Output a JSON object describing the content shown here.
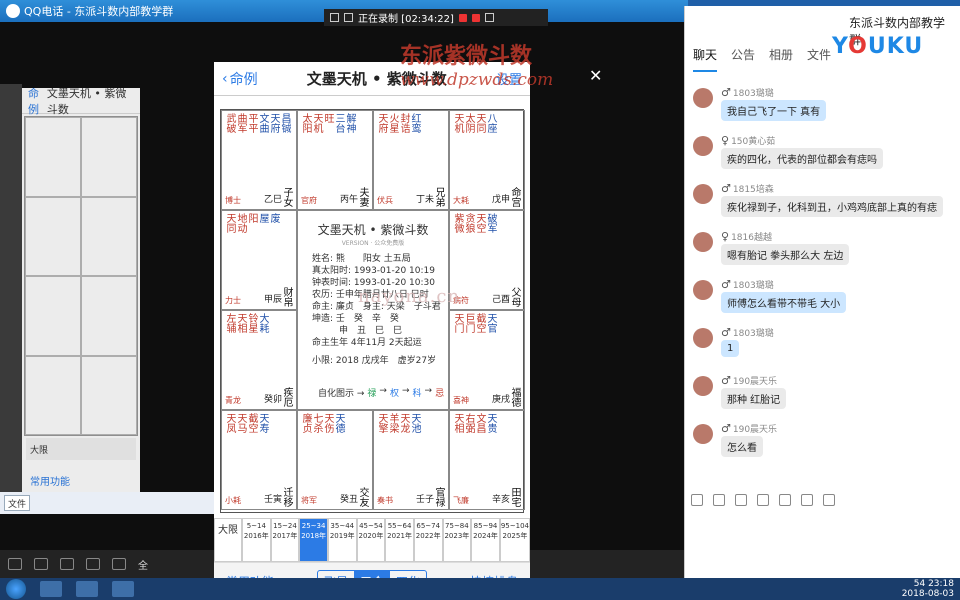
{
  "qq": {
    "title": "QQ电话 - 东派斗数内部教学群",
    "bottom_bar": "全"
  },
  "recording": {
    "label": "正在录制 [02:34:22]"
  },
  "watermark": {
    "line1": "东派紫微斗数",
    "line2": "www.dpzwds.com",
    "line3": "nayona.cn"
  },
  "left_phone": {
    "back": "命例",
    "title": "文墨天机 • 紫微斗数",
    "btn": "常用功能",
    "tab": "飞星",
    "row_label": "大限"
  },
  "phone": {
    "back": "命例",
    "title": "文墨天机 • 紫微斗数",
    "settings": "设置",
    "center": {
      "title": "文墨天机 • 紫微斗数",
      "sub": "VERSION · 公众免费版",
      "lines": [
        "姓名: 熊　　阳女 土五局",
        "真太阳时: 1993-01-20 10:19",
        "钟表时间: 1993-01-20 10:30",
        "农历: 壬申年腊月廿八日 巳时",
        "命主: 廉贞　身主: 天梁　子斗君",
        "坤造: 壬　癸　辛　癸",
        "　　　申　丑　巳　巳",
        "命主生年 4年11月 2天起运"
      ],
      "xiao": "小限: 2018 戊戌年　虚岁27岁",
      "legend_prefix": "自化图示 →",
      "legend_items": [
        "禄",
        "权",
        "科",
        "忌"
      ]
    },
    "cells": [
      {
        "stars": [
          "武破",
          "曲军",
          "平平"
        ],
        "blue": [
          "文曲",
          "天府",
          "昌铖"
        ],
        "palace": "子女",
        "gz": "乙巳",
        "label": "博士"
      },
      {
        "stars": [
          "太阳",
          "天机",
          "旺"
        ],
        "blue": [
          "三台",
          "解神"
        ],
        "palace": "夫妻",
        "gz": "丙午",
        "label": "官府"
      },
      {
        "stars": [
          "天府",
          "火星",
          "封诰"
        ],
        "blue": [
          "红鸾"
        ],
        "palace": "兄弟",
        "gz": "丁未",
        "label": "伏兵"
      },
      {
        "stars": [
          "天机",
          "太阴",
          "天同"
        ],
        "blue": [
          "八座"
        ],
        "palace": "命宫",
        "gz": "戊申",
        "label": "大耗"
      },
      {
        "stars": [
          "天同",
          "地动",
          "阳"
        ],
        "blue": [
          "屋",
          "废"
        ],
        "palace": "财帛",
        "gz": "甲辰",
        "label": "力士"
      },
      {
        "stars": [
          "紫微",
          "贪狼",
          "天空"
        ],
        "blue": [
          "破军"
        ],
        "palace": "父母",
        "gz": "己酉",
        "label": "病符"
      },
      {
        "stars": [
          "左辅",
          "天相",
          "铃星"
        ],
        "blue": [
          "大耗"
        ],
        "palace": "疾厄",
        "gz": "癸卯",
        "label": "青龙"
      },
      {
        "stars": [
          "天门",
          "巨门",
          "截空"
        ],
        "blue": [
          "天官"
        ],
        "palace": "福德",
        "gz": "庚戌",
        "label": "喜神"
      },
      {
        "stars": [
          "天凤",
          "天马",
          "截空"
        ],
        "blue": [
          "天寿"
        ],
        "palace": "迁移",
        "gz": "壬寅",
        "label": "小耗"
      },
      {
        "stars": [
          "廉贞",
          "七杀",
          "天伤"
        ],
        "blue": [
          "天德"
        ],
        "palace": "交友",
        "gz": "癸丑",
        "label": "将军"
      },
      {
        "stars": [
          "天擎",
          "羊梁",
          "天龙"
        ],
        "blue": [
          "天池"
        ],
        "palace": "官禄",
        "gz": "壬子",
        "label": "奏书"
      },
      {
        "stars": [
          "天相",
          "右弼",
          "文昌"
        ],
        "blue": [
          "天贵"
        ],
        "palace": "田宅",
        "gz": "辛亥",
        "label": "飞廉"
      }
    ],
    "dayun_header": [
      "大限",
      "流年"
    ],
    "dayun": [
      {
        "r1": "5~14",
        "r2": "2016年"
      },
      {
        "r1": "15~24",
        "r2": "2017年"
      },
      {
        "r1": "25~34",
        "r2": "2018年"
      },
      {
        "r1": "35~44",
        "r2": "2019年"
      },
      {
        "r1": "45~54",
        "r2": "2020年"
      },
      {
        "r1": "55~64",
        "r2": "2021年"
      },
      {
        "r1": "65~74",
        "r2": "2022年"
      },
      {
        "r1": "75~84",
        "r2": "2023年"
      },
      {
        "r1": "85~94",
        "r2": "2024年"
      },
      {
        "r1": "95~104",
        "r2": "2025年"
      }
    ],
    "foot": {
      "common": "常用功能",
      "seg": [
        "飞星",
        "三合",
        "四化"
      ],
      "quick": "快捷排盘"
    }
  },
  "chat": {
    "group": "东派斗数内部教学群",
    "tabs": [
      "聊天",
      "公告",
      "相册",
      "文件"
    ],
    "messages": [
      {
        "name": "1803璐璐",
        "gender": "♂",
        "text": "我自己飞了一下 真有",
        "blue": true
      },
      {
        "name": "150黄心茹",
        "gender": "♀",
        "text": "疾的四化，代表的部位都会有痣吗",
        "blue": false
      },
      {
        "name": "1815培森",
        "gender": "♂",
        "text": "疾化禄到子，化科到丑，小鸡鸡底部上真的有痣",
        "blue": false
      },
      {
        "name": "1816越越",
        "gender": "♀",
        "text": "嗯有胎记 拳头那么大 左边",
        "blue": false
      },
      {
        "name": "1803璐璐",
        "gender": "♂",
        "text": "师傅怎么看带不带毛 大小",
        "blue": true
      },
      {
        "name": "1803璐璐",
        "gender": "♂",
        "text": "1",
        "blue": true
      },
      {
        "name": "190晨天乐",
        "gender": "♂",
        "text": "那种 红胎记",
        "blue": false
      },
      {
        "name": "190晨天乐",
        "gender": "♂",
        "text": "怎么看",
        "blue": false
      }
    ]
  },
  "taskbar": {
    "time": "23:18",
    "date": "2018-08-03",
    "badge": "54"
  },
  "colors": {
    "accent": "#2c7be5",
    "star_red": "#c0392b",
    "taskbar": "#1a3d6b"
  }
}
